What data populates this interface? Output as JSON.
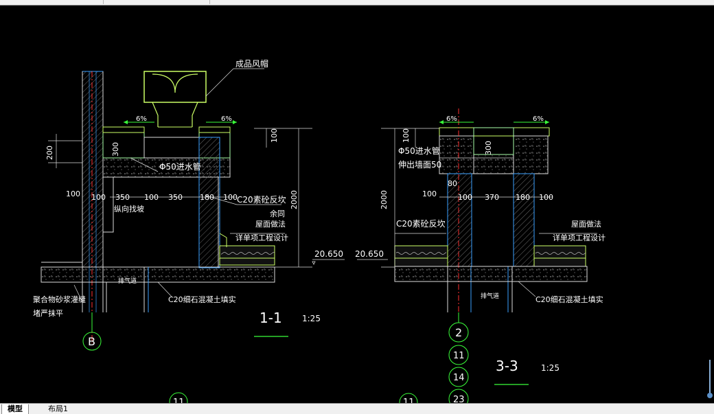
{
  "tabs": [
    {
      "label": "模型",
      "active": true
    },
    {
      "label": "布局1",
      "active": false
    }
  ],
  "drawing": {
    "annotations": {
      "product_cap": "成品风帽",
      "water_pipe": "Φ50进水管",
      "water_pipe_2": "Φ50进水管",
      "wall_ext": "伸出墙面50",
      "slope_a": "6%",
      "slope_b": "6%",
      "slope_c": "6%",
      "slope_d": "6%",
      "c20_turnup_1": "C20素砼反坎",
      "c20_turnup_2": "C20素砼反坎",
      "same": "余同",
      "roof_method_1": "屋面做法",
      "detail_1": "详单项工程设计",
      "roof_method_2": "屋面做法",
      "detail_2": "详单项工程设计",
      "longitudinal": "纵向找坡",
      "polymer_1": "聚合物砂浆灌缝",
      "polymer_2": "堵严抹平",
      "vent_1": "排气道",
      "vent_2": "排气道",
      "c20_fill_1": "C20细石混凝土填实",
      "c20_fill_2": "C20细石混凝土填实",
      "elev_1": "20.650",
      "elev_2": "20.650"
    },
    "dimensions": {
      "d200": "200",
      "d300a": "300",
      "d300b": "300",
      "d100a": "100",
      "d100b": "100",
      "d2000a": "2000",
      "d2000b": "2000",
      "d80": "80",
      "row1": [
        "100",
        "100",
        "350",
        "100",
        "350",
        "180",
        "100"
      ],
      "row2": [
        "100",
        "100",
        "370",
        "180",
        "100"
      ]
    },
    "sections": {
      "s1_label": "1-1",
      "s1_scale": "1:25",
      "s3_label": "3-3",
      "s3_scale": "1:25"
    },
    "axes": {
      "b": "B",
      "a2": "2",
      "a11a": "11",
      "a14": "14",
      "a23": "23",
      "a11b": "11",
      "a11c": "11"
    }
  }
}
